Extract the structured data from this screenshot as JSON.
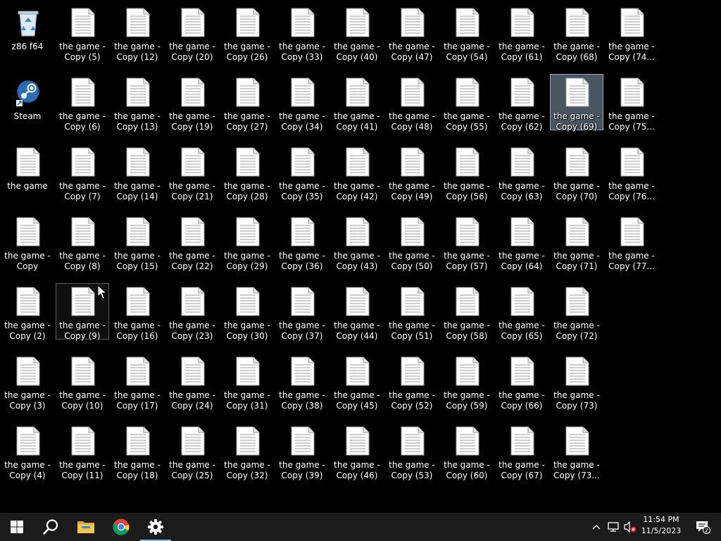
{
  "desktop": {
    "icons": [
      {
        "label": "z86 f64",
        "kind": "recycle-bin"
      },
      {
        "label": "Steam",
        "kind": "steam"
      },
      {
        "label": "the game",
        "kind": "text-file"
      },
      {
        "label": "the game -\nCopy",
        "kind": "text-file"
      },
      {
        "label": "the game -\nCopy (2)",
        "kind": "text-file"
      },
      {
        "label": "the game -\nCopy (3)",
        "kind": "text-file"
      },
      {
        "label": "the game -\nCopy (4)",
        "kind": "text-file"
      },
      {
        "label": "the game -\nCopy (5)",
        "kind": "text-file"
      },
      {
        "label": "the game -\nCopy (6)",
        "kind": "text-file"
      },
      {
        "label": "the game -\nCopy (7)",
        "kind": "text-file"
      },
      {
        "label": "the game -\nCopy (8)",
        "kind": "text-file"
      },
      {
        "label": "the game -\nCopy (9)",
        "kind": "text-file",
        "state": "hovered"
      },
      {
        "label": "the game -\nCopy (10)",
        "kind": "text-file"
      },
      {
        "label": "the game -\nCopy (11)",
        "kind": "text-file"
      },
      {
        "label": "the game -\nCopy (12)",
        "kind": "text-file"
      },
      {
        "label": "the game -\nCopy (13)",
        "kind": "text-file"
      },
      {
        "label": "the game -\nCopy (14)",
        "kind": "text-file"
      },
      {
        "label": "the game -\nCopy (15)",
        "kind": "text-file"
      },
      {
        "label": "the game -\nCopy (16)",
        "kind": "text-file"
      },
      {
        "label": "the game -\nCopy (17)",
        "kind": "text-file"
      },
      {
        "label": "the game -\nCopy (18)",
        "kind": "text-file"
      },
      {
        "label": "the game -\nCopy (20)",
        "kind": "text-file"
      },
      {
        "label": "the game -\nCopy (19)",
        "kind": "text-file"
      },
      {
        "label": "the game -\nCopy (21)",
        "kind": "text-file"
      },
      {
        "label": "the game -\nCopy (22)",
        "kind": "text-file"
      },
      {
        "label": "the game -\nCopy (23)",
        "kind": "text-file"
      },
      {
        "label": "the game -\nCopy (24)",
        "kind": "text-file"
      },
      {
        "label": "the game -\nCopy (25)",
        "kind": "text-file"
      },
      {
        "label": "the game -\nCopy (26)",
        "kind": "text-file"
      },
      {
        "label": "the game -\nCopy (27)",
        "kind": "text-file"
      },
      {
        "label": "the game -\nCopy (28)",
        "kind": "text-file"
      },
      {
        "label": "the game -\nCopy (29)",
        "kind": "text-file"
      },
      {
        "label": "the game -\nCopy (30)",
        "kind": "text-file"
      },
      {
        "label": "the game -\nCopy (31)",
        "kind": "text-file"
      },
      {
        "label": "the game -\nCopy (32)",
        "kind": "text-file"
      },
      {
        "label": "the game -\nCopy (33)",
        "kind": "text-file"
      },
      {
        "label": "the game -\nCopy (34)",
        "kind": "text-file"
      },
      {
        "label": "the game -\nCopy (35)",
        "kind": "text-file"
      },
      {
        "label": "the game -\nCopy (36)",
        "kind": "text-file"
      },
      {
        "label": "the game -\nCopy (37)",
        "kind": "text-file"
      },
      {
        "label": "the game -\nCopy (38)",
        "kind": "text-file"
      },
      {
        "label": "the game -\nCopy (39)",
        "kind": "text-file"
      },
      {
        "label": "the game -\nCopy (40)",
        "kind": "text-file"
      },
      {
        "label": "the game -\nCopy (41)",
        "kind": "text-file"
      },
      {
        "label": "the game -\nCopy (42)",
        "kind": "text-file"
      },
      {
        "label": "the game -\nCopy (43)",
        "kind": "text-file"
      },
      {
        "label": "the game -\nCopy (44)",
        "kind": "text-file"
      },
      {
        "label": "the game -\nCopy (45)",
        "kind": "text-file"
      },
      {
        "label": "the game -\nCopy (46)",
        "kind": "text-file"
      },
      {
        "label": "the game -\nCopy (47)",
        "kind": "text-file"
      },
      {
        "label": "the game -\nCopy (48)",
        "kind": "text-file"
      },
      {
        "label": "the game -\nCopy (49)",
        "kind": "text-file"
      },
      {
        "label": "the game -\nCopy (50)",
        "kind": "text-file"
      },
      {
        "label": "the game -\nCopy (51)",
        "kind": "text-file"
      },
      {
        "label": "the game -\nCopy (52)",
        "kind": "text-file"
      },
      {
        "label": "the game -\nCopy (53)",
        "kind": "text-file"
      },
      {
        "label": "the game -\nCopy (54)",
        "kind": "text-file"
      },
      {
        "label": "the game -\nCopy (55)",
        "kind": "text-file"
      },
      {
        "label": "the game -\nCopy (56)",
        "kind": "text-file"
      },
      {
        "label": "the game -\nCopy (57)",
        "kind": "text-file"
      },
      {
        "label": "the game -\nCopy (58)",
        "kind": "text-file"
      },
      {
        "label": "the game -\nCopy (59)",
        "kind": "text-file"
      },
      {
        "label": "the game -\nCopy (60)",
        "kind": "text-file"
      },
      {
        "label": "the game -\nCopy (61)",
        "kind": "text-file"
      },
      {
        "label": "the game -\nCopy (62)",
        "kind": "text-file"
      },
      {
        "label": "the game -\nCopy (63)",
        "kind": "text-file"
      },
      {
        "label": "the game -\nCopy (64)",
        "kind": "text-file"
      },
      {
        "label": "the game -\nCopy (65)",
        "kind": "text-file"
      },
      {
        "label": "the game -\nCopy (66)",
        "kind": "text-file"
      },
      {
        "label": "the game -\nCopy (67)",
        "kind": "text-file"
      },
      {
        "label": "the game -\nCopy (68)",
        "kind": "text-file"
      },
      {
        "label": "the game -\nCopy (69)",
        "kind": "text-file",
        "state": "selected"
      },
      {
        "label": "the game -\nCopy (70)",
        "kind": "text-file"
      },
      {
        "label": "the game -\nCopy (71)",
        "kind": "text-file"
      },
      {
        "label": "the game -\nCopy (72)",
        "kind": "text-file"
      },
      {
        "label": "the game -\nCopy (73)",
        "kind": "text-file"
      },
      {
        "label": "the game -\nCopy (73...",
        "kind": "text-file"
      },
      {
        "label": "the game -\nCopy (74...",
        "kind": "text-file"
      },
      {
        "label": "the game -\nCopy (75...",
        "kind": "text-file"
      },
      {
        "label": "the game -\nCopy (76...",
        "kind": "text-file"
      },
      {
        "label": "the game -\nCopy (77...",
        "kind": "text-file"
      }
    ]
  },
  "taskbar": {
    "buttons": [
      {
        "name": "start-button",
        "icon": "windows-logo-icon"
      },
      {
        "name": "search-button",
        "icon": "search-icon"
      },
      {
        "name": "file-explorer-button",
        "icon": "folder-icon"
      },
      {
        "name": "chrome-button",
        "icon": "chrome-icon"
      },
      {
        "name": "settings-button",
        "icon": "gear-icon",
        "active": true
      }
    ],
    "tray": {
      "icons": [
        "chevron-up-icon",
        "network-icon",
        "volume-muted-icon"
      ],
      "time": "11:54 PM",
      "date": "11/5/2023",
      "notification_count": "2"
    },
    "accent_color": "#76b9ed"
  }
}
